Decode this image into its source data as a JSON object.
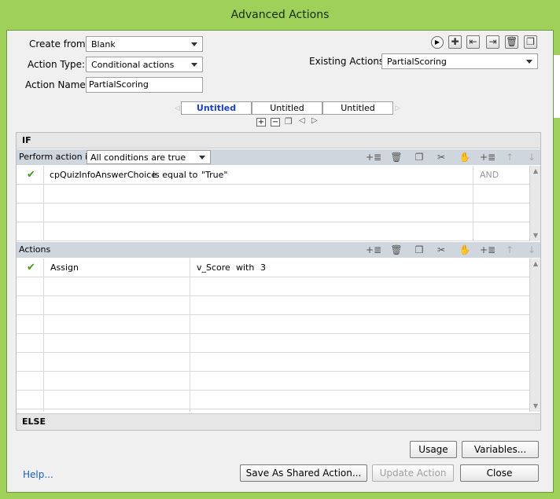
{
  "window": {
    "title": "Advanced Actions"
  },
  "form": {
    "create_from_label": "Create from:",
    "create_from_value": "Blank",
    "action_type_label": "Action Type:",
    "action_type_value": "Conditional actions",
    "action_name_label": "Action Name:",
    "action_name_value": "PartialScoring",
    "existing_actions_label": "Existing Actions:",
    "existing_actions_value": "PartialScoring"
  },
  "tabs": [
    {
      "label": "Untitled",
      "active": true
    },
    {
      "label": "Untitled",
      "active": false
    },
    {
      "label": "Untitled",
      "active": false
    }
  ],
  "if_section": {
    "header": "IF",
    "perform_label": "Perform action if:",
    "perform_value": "All conditions are true",
    "conditions": [
      {
        "variable": "cpQuizInfoAnswerChoice",
        "operator": "is equal to",
        "value": "\"True\"",
        "logic": "AND"
      }
    ]
  },
  "actions_section": {
    "header": "Actions",
    "rows": [
      {
        "action": "Assign",
        "target": "v_Score",
        "with": "with",
        "value": "3"
      }
    ]
  },
  "else_section": {
    "header": "ELSE"
  },
  "buttons": {
    "usage": "Usage",
    "variables": "Variables...",
    "save_shared": "Save As Shared Action...",
    "update": "Update Action",
    "close": "Close"
  },
  "help_link": "Help...",
  "colors": {
    "frame": "#9fd05a",
    "check": "#3c9a1e",
    "link": "#1a5fb4",
    "active_tab": "#1a3fcc"
  }
}
